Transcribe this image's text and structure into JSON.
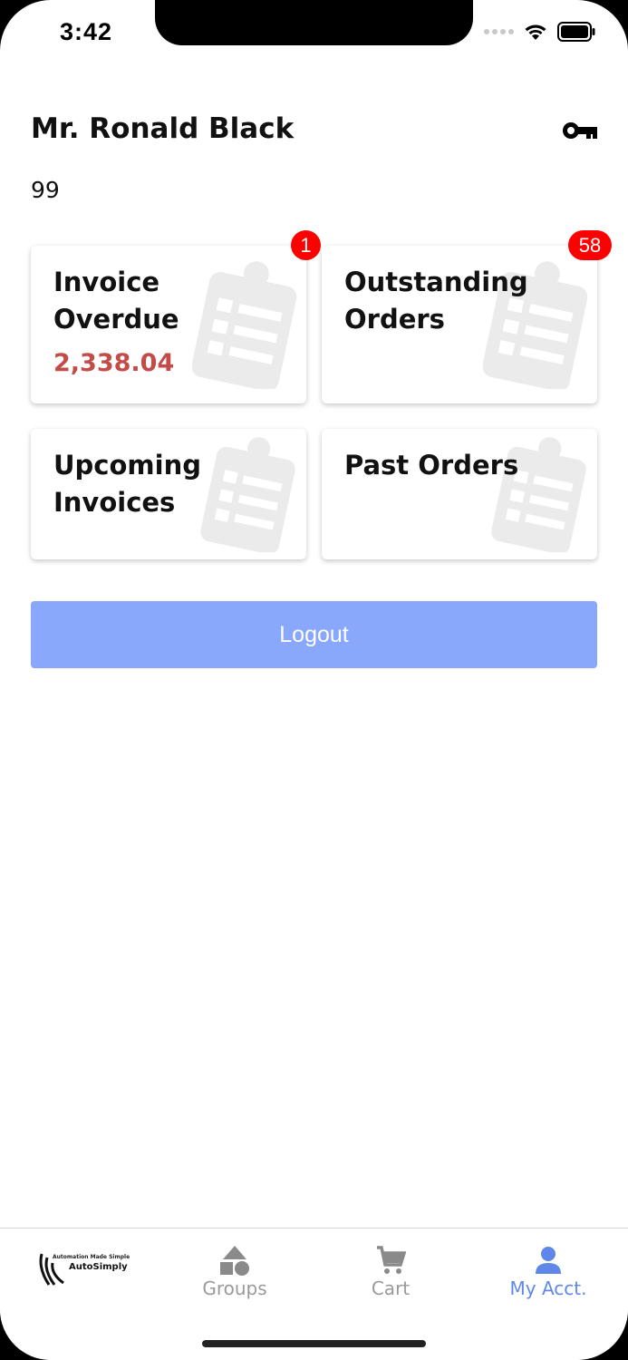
{
  "status": {
    "time": "3:42"
  },
  "user": {
    "name": "Mr. Ronald Black",
    "id": "99"
  },
  "tiles": [
    {
      "title": "Invoice Overdue",
      "value": "2,338.04",
      "badge": "1"
    },
    {
      "title": "Outstanding Orders",
      "badge": "58"
    },
    {
      "title": "Upcoming Invoices"
    },
    {
      "title": "Past Orders"
    }
  ],
  "logout_label": "Logout",
  "tabbar": {
    "logo": {
      "tagline": "Automation Made Simple",
      "brand": "AutoSimply"
    },
    "tabs": [
      {
        "label": "Groups",
        "icon": "shapes-icon"
      },
      {
        "label": "Cart",
        "icon": "cart-icon"
      },
      {
        "label": "My Acct.",
        "icon": "person-icon",
        "active": true
      }
    ]
  },
  "colors": {
    "accent": "#5f87ea",
    "logout_bg": "#8aa8fb",
    "badge": "#ff0000",
    "overdue_value": "#c44b48"
  }
}
